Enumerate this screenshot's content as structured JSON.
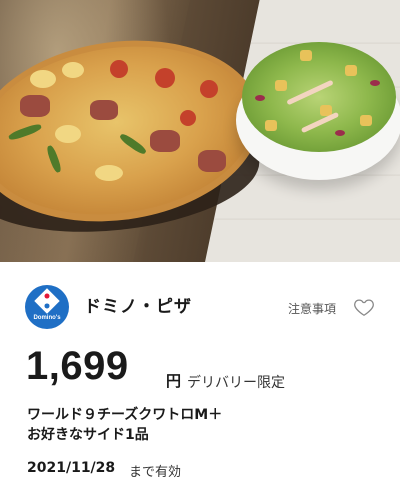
{
  "brand": {
    "name": "ドミノ・ピザ",
    "logo_text": "Domino's",
    "logo_color": "#1f6fc5",
    "logo_accent": "#e31837"
  },
  "actions": {
    "notes_label": "注意事項",
    "favorite_icon": "heart-outline-icon"
  },
  "offer": {
    "price": "1,699",
    "currency": "円",
    "price_note": "デリバリー限定",
    "title_line1": "ワールド９チーズクワトロM＋",
    "title_line2": "お好きなサイド1品",
    "expiry_date": "2021/11/28",
    "expiry_suffix": "まで有効"
  }
}
